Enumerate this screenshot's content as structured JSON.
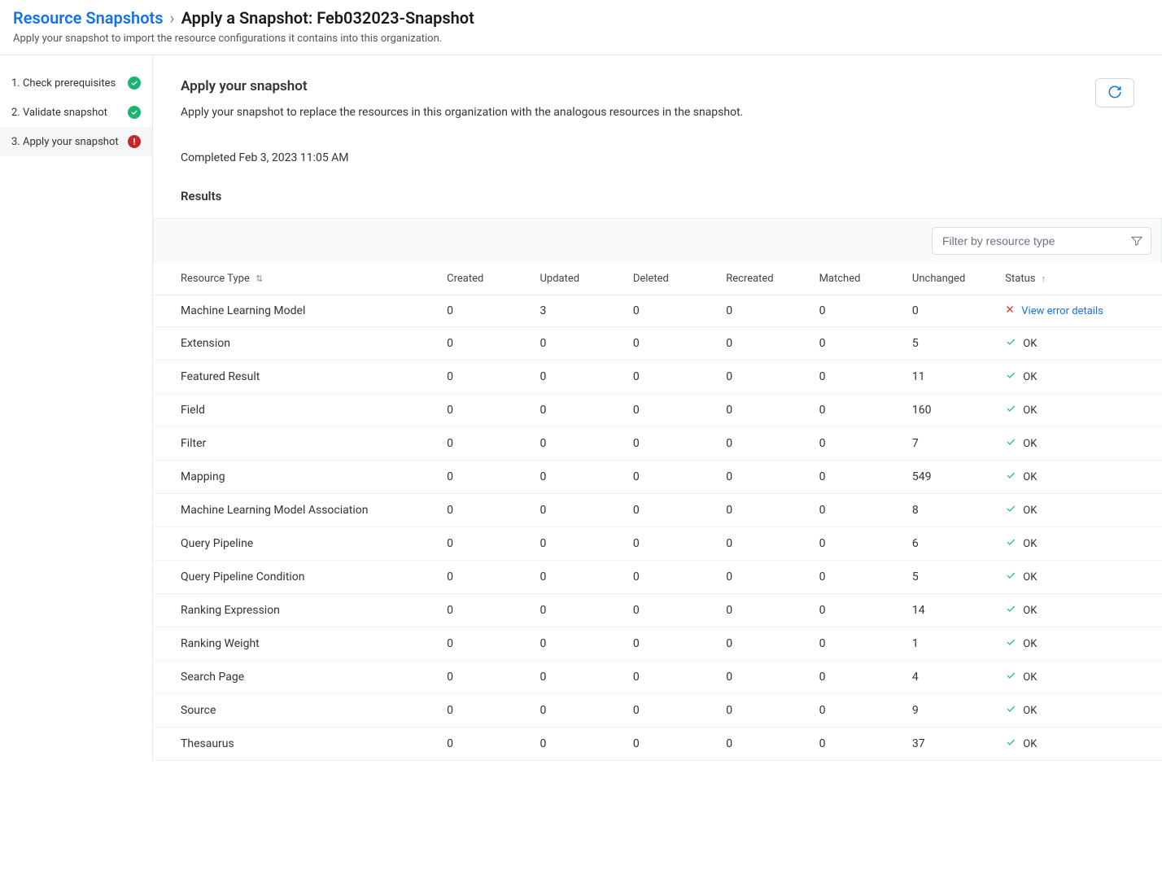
{
  "breadcrumb": {
    "parent": "Resource Snapshots",
    "current": "Apply a Snapshot: Feb032023-Snapshot"
  },
  "page_subtitle": "Apply your snapshot to import the resource configurations it contains into this organization.",
  "sidebar": {
    "steps": [
      {
        "label": "1. Check prerequisites",
        "status": "ok",
        "active": false
      },
      {
        "label": "2. Validate snapshot",
        "status": "ok",
        "active": false
      },
      {
        "label": "3. Apply your snapshot",
        "status": "error",
        "active": true
      }
    ]
  },
  "main": {
    "title": "Apply your snapshot",
    "description": "Apply your snapshot to replace the resources in this organization with the analogous resources in the snapshot.",
    "timestamp": "Completed Feb 3, 2023 11:05 AM",
    "results_title": "Results"
  },
  "filter": {
    "placeholder": "Filter by resource type"
  },
  "table": {
    "headers": {
      "resource_type": "Resource Type",
      "created": "Created",
      "updated": "Updated",
      "deleted": "Deleted",
      "recreated": "Recreated",
      "matched": "Matched",
      "unchanged": "Unchanged",
      "status": "Status"
    },
    "status_labels": {
      "ok": "OK",
      "error": "View error details"
    },
    "rows": [
      {
        "type": "Machine Learning Model",
        "created": "0",
        "updated": "3",
        "deleted": "0",
        "recreated": "0",
        "matched": "0",
        "unchanged": "0",
        "status": "error"
      },
      {
        "type": "Extension",
        "created": "0",
        "updated": "0",
        "deleted": "0",
        "recreated": "0",
        "matched": "0",
        "unchanged": "5",
        "status": "ok"
      },
      {
        "type": "Featured Result",
        "created": "0",
        "updated": "0",
        "deleted": "0",
        "recreated": "0",
        "matched": "0",
        "unchanged": "11",
        "status": "ok"
      },
      {
        "type": "Field",
        "created": "0",
        "updated": "0",
        "deleted": "0",
        "recreated": "0",
        "matched": "0",
        "unchanged": "160",
        "status": "ok"
      },
      {
        "type": "Filter",
        "created": "0",
        "updated": "0",
        "deleted": "0",
        "recreated": "0",
        "matched": "0",
        "unchanged": "7",
        "status": "ok"
      },
      {
        "type": "Mapping",
        "created": "0",
        "updated": "0",
        "deleted": "0",
        "recreated": "0",
        "matched": "0",
        "unchanged": "549",
        "status": "ok"
      },
      {
        "type": "Machine Learning Model Association",
        "created": "0",
        "updated": "0",
        "deleted": "0",
        "recreated": "0",
        "matched": "0",
        "unchanged": "8",
        "status": "ok"
      },
      {
        "type": "Query Pipeline",
        "created": "0",
        "updated": "0",
        "deleted": "0",
        "recreated": "0",
        "matched": "0",
        "unchanged": "6",
        "status": "ok"
      },
      {
        "type": "Query Pipeline Condition",
        "created": "0",
        "updated": "0",
        "deleted": "0",
        "recreated": "0",
        "matched": "0",
        "unchanged": "5",
        "status": "ok"
      },
      {
        "type": "Ranking Expression",
        "created": "0",
        "updated": "0",
        "deleted": "0",
        "recreated": "0",
        "matched": "0",
        "unchanged": "14",
        "status": "ok"
      },
      {
        "type": "Ranking Weight",
        "created": "0",
        "updated": "0",
        "deleted": "0",
        "recreated": "0",
        "matched": "0",
        "unchanged": "1",
        "status": "ok"
      },
      {
        "type": "Search Page",
        "created": "0",
        "updated": "0",
        "deleted": "0",
        "recreated": "0",
        "matched": "0",
        "unchanged": "4",
        "status": "ok"
      },
      {
        "type": "Source",
        "created": "0",
        "updated": "0",
        "deleted": "0",
        "recreated": "0",
        "matched": "0",
        "unchanged": "9",
        "status": "ok"
      },
      {
        "type": "Thesaurus",
        "created": "0",
        "updated": "0",
        "deleted": "0",
        "recreated": "0",
        "matched": "0",
        "unchanged": "37",
        "status": "ok"
      }
    ]
  }
}
